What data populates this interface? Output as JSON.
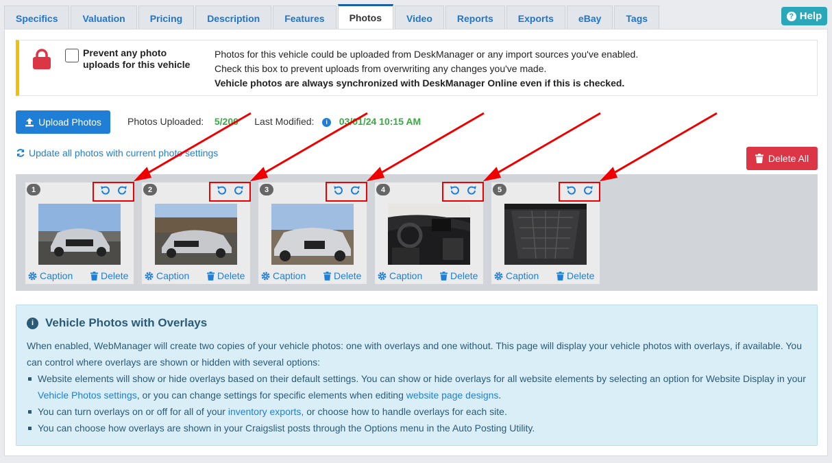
{
  "tabs": [
    {
      "label": "Specifics"
    },
    {
      "label": "Valuation"
    },
    {
      "label": "Pricing"
    },
    {
      "label": "Description"
    },
    {
      "label": "Features"
    },
    {
      "label": "Photos",
      "active": true
    },
    {
      "label": "Video"
    },
    {
      "label": "Reports"
    },
    {
      "label": "Exports"
    },
    {
      "label": "eBay"
    },
    {
      "label": "Tags"
    }
  ],
  "help": {
    "label": "Help"
  },
  "lock": {
    "checkbox_label": "Prevent any photo uploads for this vehicle",
    "line1": "Photos for this vehicle could be uploaded from DeskManager or any import sources you've enabled.",
    "line2": "Check this box to prevent uploads from overwriting any changes you've made.",
    "line3": "Vehicle photos are always synchronized with DeskManager Online even if this is checked."
  },
  "toolbar": {
    "upload_label": "Upload Photos",
    "uploaded_label": "Photos Uploaded:",
    "uploaded_value": "5/200",
    "modified_label": "Last Modified:",
    "modified_value": "03/01/24 10:15 AM",
    "update_link": "Update all photos with current photo settings",
    "delete_all_label": "Delete All"
  },
  "photos": [
    {
      "number": "1",
      "caption_label": "Caption",
      "delete_label": "Delete"
    },
    {
      "number": "2",
      "caption_label": "Caption",
      "delete_label": "Delete"
    },
    {
      "number": "3",
      "caption_label": "Caption",
      "delete_label": "Delete"
    },
    {
      "number": "4",
      "caption_label": "Caption",
      "delete_label": "Delete"
    },
    {
      "number": "5",
      "caption_label": "Caption",
      "delete_label": "Delete"
    }
  ],
  "overlays": {
    "title": "Vehicle Photos with Overlays",
    "intro": "When enabled, WebManager will create two copies of your vehicle photos: one with overlays and one without. This page will display your vehicle photos with overlays, if available. You can control where overlays are shown or hidden with several options:",
    "b1_pre": "Website elements will show or hide overlays based on their default settings. You can show or hide overlays for all website elements by selecting an option for Website Display in your ",
    "b1_link1": "Vehicle Photos settings",
    "b1_mid": ", or you can change settings for specific elements when editing ",
    "b1_link2": "website page designs",
    "b1_end": ".",
    "b2_pre": "You can turn overlays on or off for all of your ",
    "b2_link": "inventory exports,",
    "b2_end": " or choose how to handle overlays for each site.",
    "b3": "You can choose how overlays are shown in your Craigslist posts through the Options menu in the Auto Posting Utility."
  },
  "colors": {
    "accent": "#1f7fd6",
    "danger": "#dc3545",
    "success": "#3aa845",
    "annotation": "#ee0000"
  }
}
